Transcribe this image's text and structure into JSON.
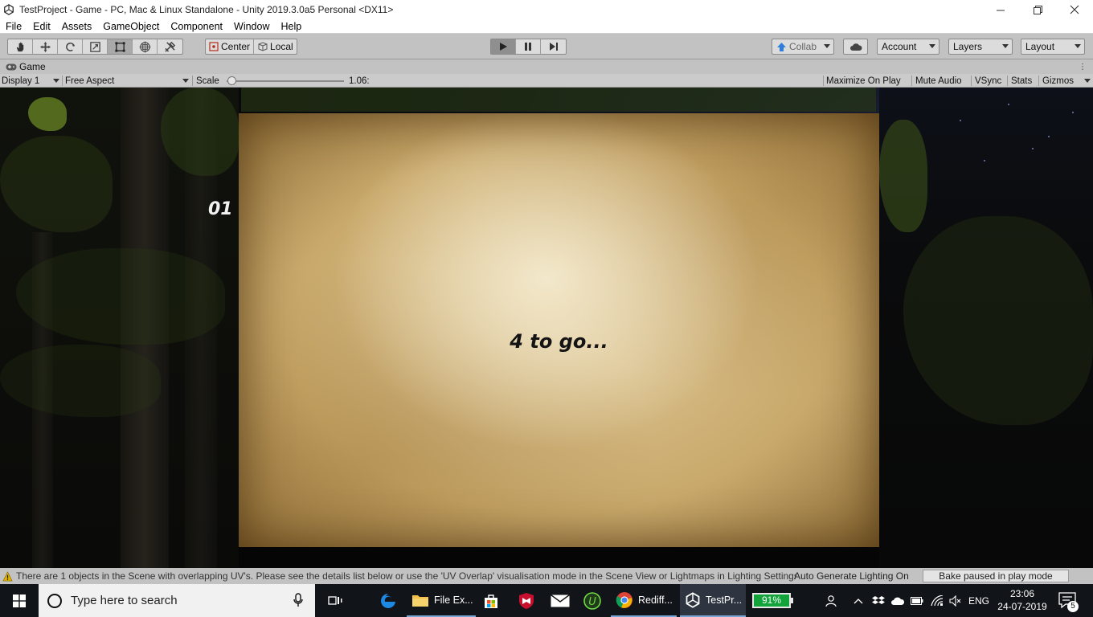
{
  "window": {
    "title": "TestProject - Game - PC, Mac & Linux Standalone - Unity 2019.3.0a5 Personal <DX11>",
    "controls": [
      "minimize-icon",
      "maximize-icon",
      "close-icon"
    ]
  },
  "menu": [
    "File",
    "Edit",
    "Assets",
    "GameObject",
    "Component",
    "Window",
    "Help"
  ],
  "toolbar": {
    "tools": [
      "hand-tool-icon",
      "move-tool-icon",
      "rotate-tool-icon",
      "scale-tool-icon",
      "rect-tool-icon",
      "transform-tool-icon",
      "custom-tool-icon"
    ],
    "active_tool": "rect-tool-icon",
    "pivot_label": "Center",
    "space_label": "Local",
    "collab_label": "Collab",
    "account_label": "Account",
    "layers_label": "Layers",
    "layout_label": "Layout"
  },
  "game_tab": {
    "label": "Game"
  },
  "game_toolbar": {
    "display": "Display 1",
    "aspect": "Free Aspect",
    "scale_label": "Scale",
    "scale_value": "1.06:",
    "scale_fraction": 0.04,
    "maximize_on_play": "Maximize On Play",
    "mute_audio": "Mute Audio",
    "vsync": "VSync",
    "stats": "Stats",
    "gizmos": "Gizmos"
  },
  "game": {
    "level_number": "01",
    "message": "4 to go..."
  },
  "status": {
    "warning": "There are 1 objects in the Scene with overlapping UV's. Please see the details list below or use the 'UV Overlap' visualisation mode in the Scene View or Lightmaps in Lighting Settings for more information.",
    "auto_generate": "Auto Generate Lighting On",
    "bake": "Bake paused in play mode"
  },
  "taskbar": {
    "search_placeholder": "Type here to search",
    "apps": [
      {
        "label": "File Ex...",
        "icon": "folder-icon"
      },
      {
        "label": "Rediff...",
        "icon": "chrome-icon"
      },
      {
        "label": "TestPr...",
        "icon": "unity-icon"
      }
    ],
    "battery": "91%",
    "language": "ENG",
    "time": "23:06",
    "date": "24-07-2019",
    "notifications": "5",
    "colors": {
      "taskbar": "#111418",
      "battery": "#12a33a",
      "accent": "#7aa6d6"
    }
  }
}
